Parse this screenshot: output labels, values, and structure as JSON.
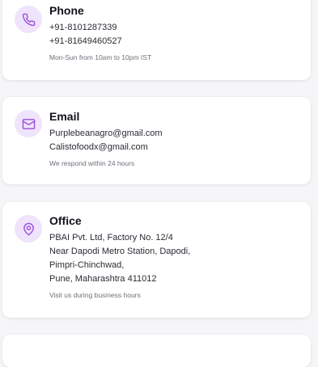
{
  "colors": {
    "accent": "#9b4fd9",
    "icon_bg": "#efe4fb",
    "card_bg": "#ffffff",
    "page_bg": "#f6f6f8"
  },
  "contact": {
    "phone": {
      "icon": "phone-icon",
      "title": "Phone",
      "lines": [
        "+91-8101287339",
        "+91-81649460527"
      ],
      "note": "Mon-Sun from 10am to 10pm IST"
    },
    "email": {
      "icon": "mail-icon",
      "title": "Email",
      "lines": [
        "Purplebeanagro@gmail.com",
        "Calistofoodx@gmail.com"
      ],
      "note": "We respond within 24 hours"
    },
    "office": {
      "icon": "map-pin-icon",
      "title": "Office",
      "lines": [
        "PBAI Pvt. Ltd, Factory No. 12/4",
        "Near Dapodi Metro Station, Dapodi,",
        "Pimpri-Chinchwad,",
        "Pune, Maharashtra 411012"
      ],
      "note": "Visit us during business hours"
    }
  }
}
